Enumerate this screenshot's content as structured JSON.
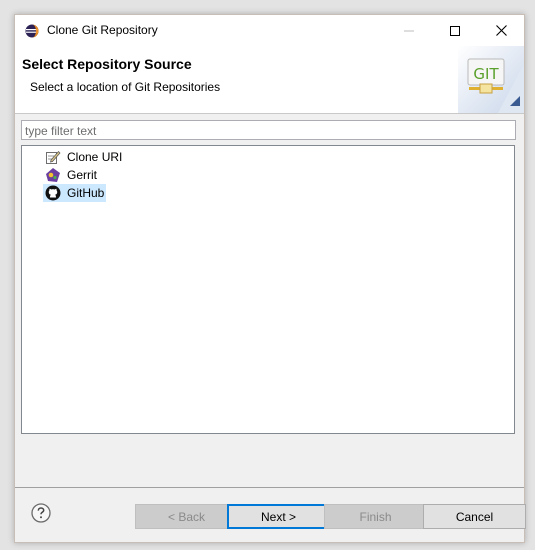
{
  "window": {
    "title": "Clone Git Repository"
  },
  "header": {
    "title": "Select Repository Source",
    "description": "Select a location of Git Repositories",
    "banner_text": "GIT"
  },
  "filter": {
    "placeholder": "type filter text",
    "value": ""
  },
  "sources": [
    {
      "label": "Clone URI",
      "icon": "clone-uri-icon"
    },
    {
      "label": "Gerrit",
      "icon": "gerrit-icon"
    },
    {
      "label": "GitHub",
      "icon": "github-icon",
      "selected": true
    }
  ],
  "footer": {
    "back_label": "< Back",
    "next_label": "Next >",
    "finish_label": "Finish",
    "cancel_label": "Cancel"
  },
  "colors": {
    "selection": "#cce8ff",
    "accent": "#0078d7"
  }
}
